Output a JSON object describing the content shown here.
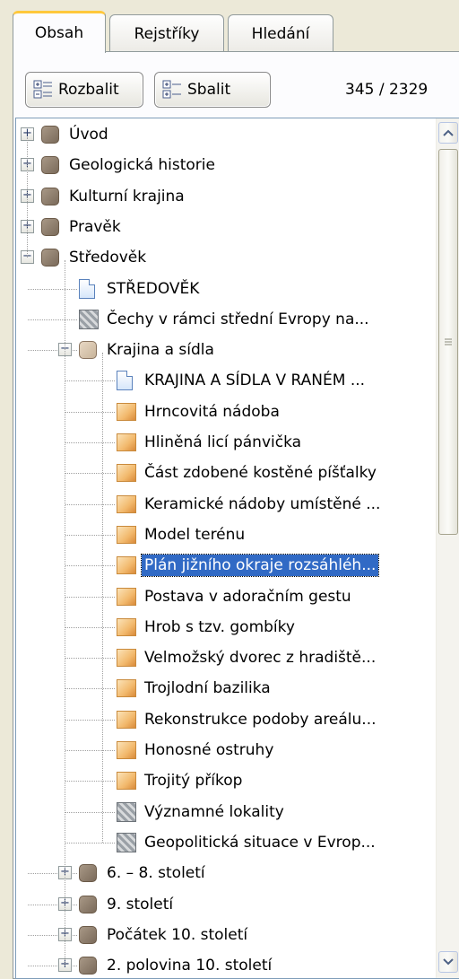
{
  "tabs": [
    "Obsah",
    "Rejstříky",
    "Hledání"
  ],
  "toolbar": {
    "expand_label": "Rozbalit",
    "collapse_label": "Sbalit",
    "counter": "345 / 2329"
  },
  "tree": [
    {
      "label": "Úvod",
      "level": 0,
      "icon": "book-closed",
      "expander": "plus"
    },
    {
      "label": "Geologická historie",
      "level": 0,
      "icon": "book-closed",
      "expander": "plus"
    },
    {
      "label": "Kulturní krajina",
      "level": 0,
      "icon": "book-closed",
      "expander": "plus"
    },
    {
      "label": "Pravěk",
      "level": 0,
      "icon": "book-closed",
      "expander": "plus"
    },
    {
      "label": "Středověk",
      "level": 0,
      "icon": "book-closed",
      "expander": "minus"
    },
    {
      "label": "STŘEDOVĚK",
      "level": 1,
      "icon": "document",
      "expander": "none"
    },
    {
      "label": "Čechy v rámci střední Evropy na...",
      "level": 1,
      "icon": "map",
      "expander": "none"
    },
    {
      "label": "Krajina a sídla",
      "level": 1,
      "icon": "book-open",
      "expander": "minus"
    },
    {
      "label": "KRAJINA A SÍDLA V RANÉM ...",
      "level": 2,
      "icon": "document",
      "expander": "none"
    },
    {
      "label": "Hrncovitá nádoba",
      "level": 2,
      "icon": "image",
      "expander": "none"
    },
    {
      "label": "Hliněná licí pánvička",
      "level": 2,
      "icon": "image",
      "expander": "none"
    },
    {
      "label": "Část zdobené kostěné píšťalky",
      "level": 2,
      "icon": "image",
      "expander": "none"
    },
    {
      "label": "Keramické nádoby umístěné ...",
      "level": 2,
      "icon": "image",
      "expander": "none"
    },
    {
      "label": "Model terénu",
      "level": 2,
      "icon": "image",
      "expander": "none"
    },
    {
      "label": "Plán jižního okraje rozsáhléh...",
      "level": 2,
      "icon": "image",
      "expander": "none",
      "selected": true
    },
    {
      "label": "Postava v adoračním gestu",
      "level": 2,
      "icon": "image",
      "expander": "none"
    },
    {
      "label": "Hrob s tzv. gombíky",
      "level": 2,
      "icon": "image",
      "expander": "none"
    },
    {
      "label": "Velmožský dvorec z hradiště...",
      "level": 2,
      "icon": "image",
      "expander": "none"
    },
    {
      "label": "Trojlodní bazilika",
      "level": 2,
      "icon": "image",
      "expander": "none"
    },
    {
      "label": "Rekonstrukce podoby areálu...",
      "level": 2,
      "icon": "image",
      "expander": "none"
    },
    {
      "label": "Honosné ostruhy",
      "level": 2,
      "icon": "image",
      "expander": "none"
    },
    {
      "label": "Trojitý příkop",
      "level": 2,
      "icon": "image",
      "expander": "none"
    },
    {
      "label": "Významné lokality",
      "level": 2,
      "icon": "map",
      "expander": "none"
    },
    {
      "label": "Geopolitická situace v Evrop...",
      "level": 2,
      "icon": "map",
      "expander": "none"
    },
    {
      "label": "6. – 8. století",
      "level": 1,
      "icon": "book-closed",
      "expander": "plus"
    },
    {
      "label": "9. století",
      "level": 1,
      "icon": "book-closed",
      "expander": "plus"
    },
    {
      "label": "Počátek 10. století",
      "level": 1,
      "icon": "book-closed",
      "expander": "plus"
    },
    {
      "label": "2. polovina 10. století",
      "level": 1,
      "icon": "book-closed",
      "expander": "plus"
    }
  ],
  "colors": {
    "selection": "#316ac5",
    "active_tab_accent": "#ffc83c",
    "window_bg": "#ece9d8"
  }
}
